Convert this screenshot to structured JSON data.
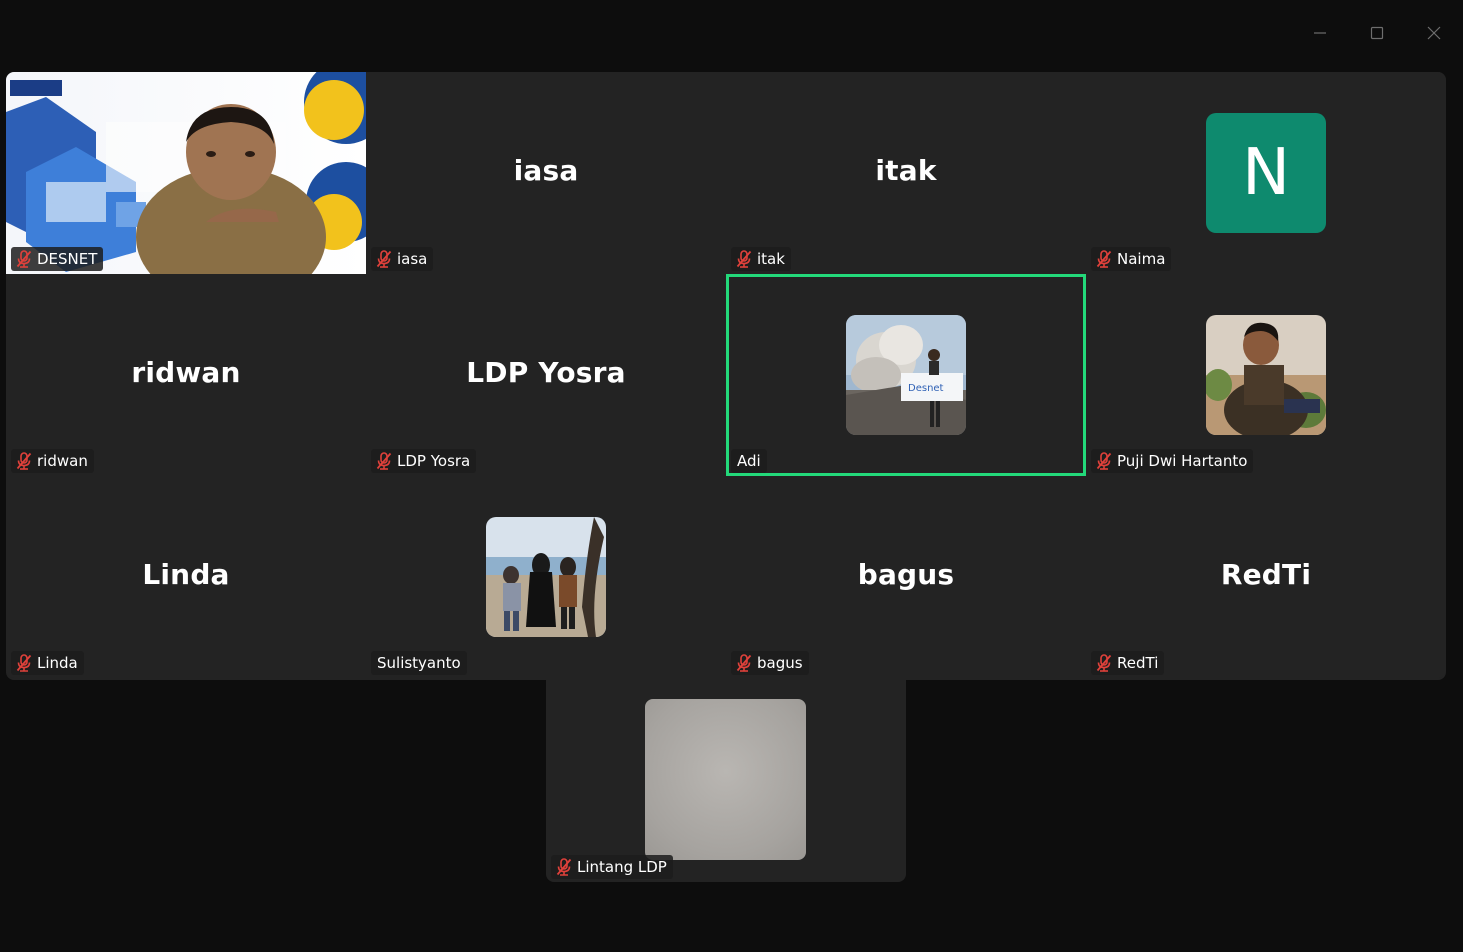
{
  "window": {
    "controls": {
      "minimize_icon": "minimize-icon",
      "maximize_icon": "maximize-icon",
      "close_icon": "close-icon"
    }
  },
  "colors": {
    "background": "#0d0d0d",
    "tile": "#232323",
    "active_speaker": "#23d97a",
    "muted_mic": "#e0413b",
    "avatar_n": "#0e8a6e"
  },
  "participants": [
    {
      "name": "DESNET",
      "muted": true,
      "video": "camera"
    },
    {
      "name": "iasa",
      "display": "iasa",
      "muted": true
    },
    {
      "name": "itak",
      "display": "itak",
      "muted": true
    },
    {
      "name": "Naima",
      "avatar_letter": "N",
      "muted": true
    },
    {
      "name": "ridwan",
      "display": "ridwan",
      "muted": true
    },
    {
      "name": "LDP Yosra",
      "display": "LDP Yosra",
      "muted": true
    },
    {
      "name": "Adi",
      "muted": false,
      "active_speaker": true
    },
    {
      "name": "Puji Dwi Hartanto",
      "muted": true
    },
    {
      "name": "Linda",
      "display": "Linda",
      "muted": true
    },
    {
      "name": "Sulistyanto",
      "muted": false
    },
    {
      "name": "bagus",
      "display": "bagus",
      "muted": true
    },
    {
      "name": "RedTi",
      "display": "RedTi",
      "muted": true
    },
    {
      "name": "Lintang LDP",
      "muted": true
    }
  ]
}
